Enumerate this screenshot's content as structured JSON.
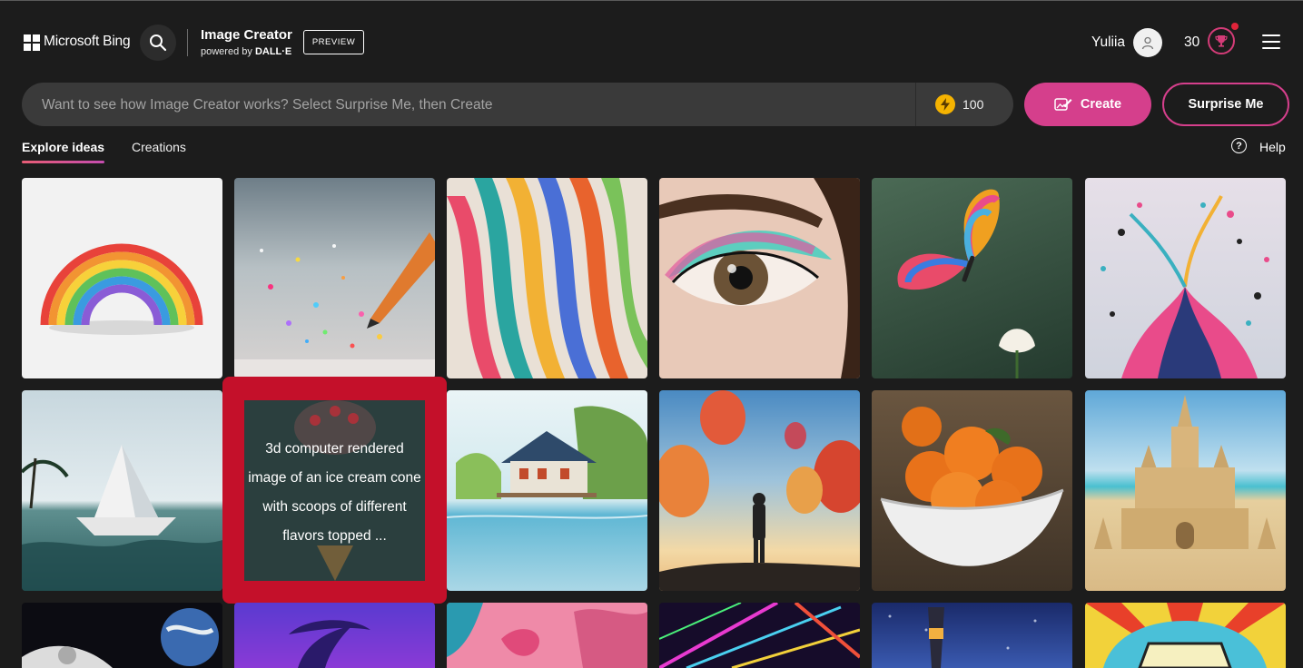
{
  "header": {
    "brand": "Microsoft Bing",
    "app_title": "Image Creator",
    "powered_by_prefix": "powered by",
    "powered_by_brand": "DALL·E",
    "badge": "PREVIEW",
    "user_name": "Yuliia",
    "rewards_count": "30"
  },
  "prompt": {
    "placeholder": "Want to see how Image Creator works? Select Surprise Me, then Create",
    "value": "",
    "boosts": "100"
  },
  "buttons": {
    "create": "Create",
    "surprise_me": "Surprise Me"
  },
  "tabs": [
    {
      "label": "Explore ideas",
      "active": true
    },
    {
      "label": "Creations",
      "active": false
    }
  ],
  "help": {
    "label": "Help",
    "icon": "?"
  },
  "gallery": {
    "tiles": [
      {
        "subject": "rainbow"
      },
      {
        "subject": "pencil-sparkles"
      },
      {
        "subject": "colorful-ribbons"
      },
      {
        "subject": "eye-makeup"
      },
      {
        "subject": "butterfly"
      },
      {
        "subject": "paint-splash"
      },
      {
        "subject": "paper-boat"
      },
      {
        "subject": "ice-cream-cone"
      },
      {
        "subject": "lake-house"
      },
      {
        "subject": "hot-air-balloons"
      },
      {
        "subject": "oranges-bowl"
      },
      {
        "subject": "sand-castle"
      },
      {
        "subject": "astronaut-earth"
      },
      {
        "subject": "palm-neon"
      },
      {
        "subject": "flamingo"
      },
      {
        "subject": "laser-lights"
      },
      {
        "subject": "lighthouse"
      },
      {
        "subject": "pop-art-drink"
      }
    ],
    "hover_caption": "3d computer rendered image of an ice cream cone with scoops of different flavors topped ..."
  },
  "colors": {
    "background": "#1c1c1c",
    "accent": "#d53f8c",
    "highlight": "#c4102a",
    "coin": "#f5b301"
  }
}
